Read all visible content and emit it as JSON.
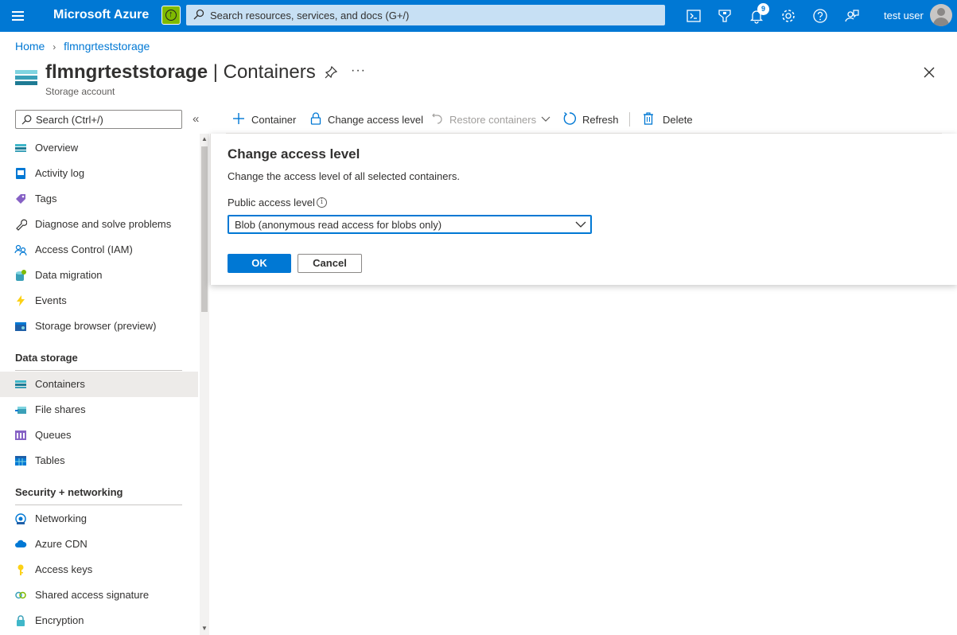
{
  "topbar": {
    "brand": "Microsoft Azure",
    "search_placeholder": "Search resources, services, and docs (G+/)",
    "notification_count": "9",
    "user_name": "test user"
  },
  "breadcrumb": {
    "home": "Home",
    "resource": "flmngrteststorage"
  },
  "header": {
    "resource_name": "flmngrteststorage",
    "separator": " | ",
    "page_name": "Containers",
    "subtitle": "Storage account",
    "more": "···"
  },
  "sidebar": {
    "search_placeholder": "Search (Ctrl+/)",
    "collapse": "«",
    "items": [
      {
        "label": "Overview",
        "icon": "overview-icon"
      },
      {
        "label": "Activity log",
        "icon": "activity-log-icon"
      },
      {
        "label": "Tags",
        "icon": "tag-icon"
      },
      {
        "label": "Diagnose and solve problems",
        "icon": "wrench-icon"
      },
      {
        "label": "Access Control (IAM)",
        "icon": "people-icon"
      },
      {
        "label": "Data migration",
        "icon": "data-migration-icon"
      },
      {
        "label": "Events",
        "icon": "lightning-icon"
      },
      {
        "label": "Storage browser (preview)",
        "icon": "storage-browser-icon"
      }
    ],
    "section_data_storage": "Data storage",
    "data_storage_items": [
      {
        "label": "Containers",
        "icon": "containers-icon"
      },
      {
        "label": "File shares",
        "icon": "file-shares-icon"
      },
      {
        "label": "Queues",
        "icon": "queues-icon"
      },
      {
        "label": "Tables",
        "icon": "tables-icon"
      }
    ],
    "section_security": "Security + networking",
    "security_items": [
      {
        "label": "Networking",
        "icon": "networking-icon"
      },
      {
        "label": "Azure CDN",
        "icon": "cloud-icon"
      },
      {
        "label": "Access keys",
        "icon": "key-icon"
      },
      {
        "label": "Shared access signature",
        "icon": "link-icon"
      },
      {
        "label": "Encryption",
        "icon": "lock-icon"
      }
    ]
  },
  "commands": {
    "add_container": "Container",
    "change_access": "Change access level",
    "restore": "Restore containers",
    "refresh": "Refresh",
    "delete": "Delete"
  },
  "panel": {
    "title": "Change access level",
    "description": "Change the access level of all selected containers.",
    "field_label": "Public access level",
    "selected_value": "Blob (anonymous read access for blobs only)",
    "ok_label": "OK",
    "cancel_label": "Cancel"
  },
  "colors": {
    "accent": "#0078d4",
    "topbar": "#0078d4",
    "search_bg": "#c7e0f4"
  }
}
